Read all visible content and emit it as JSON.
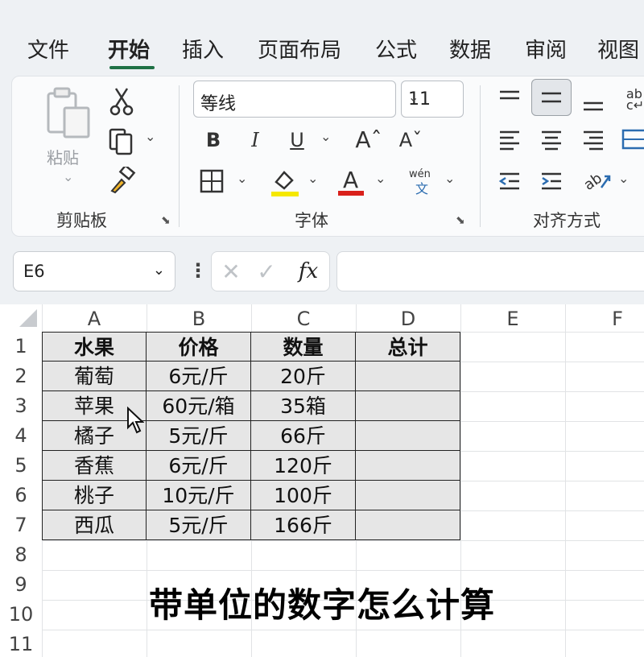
{
  "tabs": [
    {
      "label": "文件"
    },
    {
      "label": "开始"
    },
    {
      "label": "插入"
    },
    {
      "label": "页面布局"
    },
    {
      "label": "公式"
    },
    {
      "label": "数据"
    },
    {
      "label": "审阅"
    },
    {
      "label": "视图"
    }
  ],
  "ribbon": {
    "clipboard": {
      "label": "剪贴板",
      "paste_label": "粘贴"
    },
    "font": {
      "label": "字体",
      "font_name": "等线",
      "font_size": "11"
    },
    "alignment": {
      "label": "对齐方式"
    },
    "colors": {
      "highlight": "#f5e800",
      "font_color": "#d9201b",
      "accent": "#1e7145"
    }
  },
  "formula_bar": {
    "name_box": "E6",
    "fx": "fx",
    "formula": ""
  },
  "columns": [
    "A",
    "B",
    "C",
    "D",
    "E",
    "F"
  ],
  "rows": [
    "1",
    "2",
    "3",
    "4",
    "5",
    "6",
    "7",
    "8",
    "9",
    "10",
    "11"
  ],
  "table": {
    "headers": [
      "水果",
      "价格",
      "数量",
      "总计"
    ],
    "rows": [
      [
        "葡萄",
        "6元/斤",
        "20斤",
        ""
      ],
      [
        "苹果",
        "60元/箱",
        "35箱",
        ""
      ],
      [
        "橘子",
        "5元/斤",
        "66斤",
        ""
      ],
      [
        "香蕉",
        "6元/斤",
        "120斤",
        ""
      ],
      [
        "桃子",
        "10元/斤",
        "100斤",
        ""
      ],
      [
        "西瓜",
        "5元/斤",
        "166斤",
        ""
      ]
    ]
  },
  "caption": "带单位的数字怎么计算"
}
